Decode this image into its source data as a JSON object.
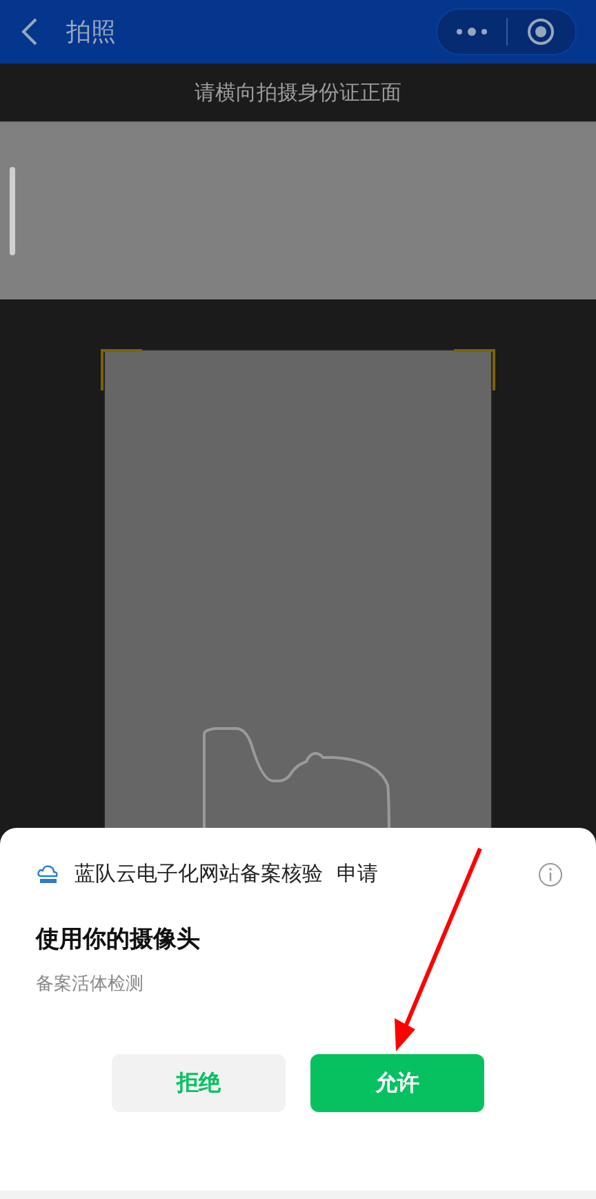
{
  "nav": {
    "title": "拍照"
  },
  "hint": "请横向拍摄身份证正面",
  "dialog": {
    "app_name": "蓝队云电子化网站备案核验",
    "action": "申请",
    "permission": "使用你的摄像头",
    "purpose": "备案活体检测",
    "buttons": [
      {
        "label": "拒绝",
        "kind": "secondary"
      },
      {
        "label": "允许",
        "kind": "primary"
      }
    ]
  }
}
